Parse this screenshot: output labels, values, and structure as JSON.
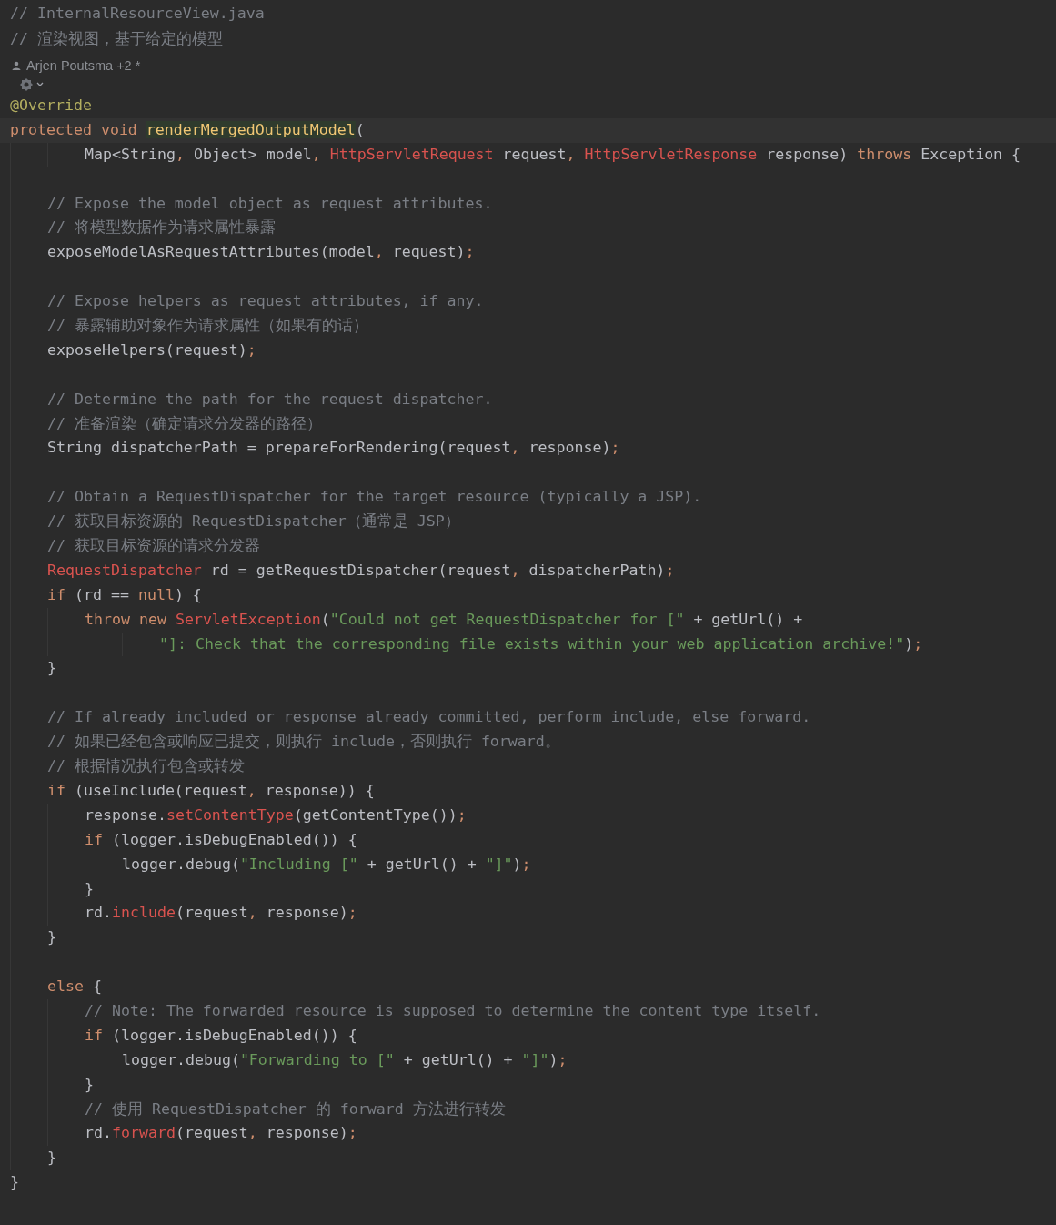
{
  "header_comments": [
    [
      {
        "kind": "comment",
        "text": "// InternalResourceView.java"
      }
    ],
    [
      {
        "kind": "comment",
        "text": "// 渲染视图，基于给定的模型"
      }
    ]
  ],
  "author_hint": {
    "text": "Arjen Poutsma +2 *"
  },
  "code": [
    {
      "kind": "line",
      "current": false,
      "tokens": [
        {
          "kind": "annotation",
          "text": "@Override"
        }
      ]
    },
    {
      "kind": "line",
      "current": true,
      "tokens": [
        {
          "kind": "keyword",
          "text": "protected void "
        },
        {
          "kind": "declaration",
          "text": "renderMergedOutputModel"
        },
        {
          "kind": "plain",
          "text": "("
        }
      ]
    },
    {
      "kind": "block",
      "children": [
        {
          "kind": "block",
          "children": [
            {
              "kind": "line",
              "current": false,
              "tokens": [
                {
                  "kind": "plain",
                  "text": "Map<String"
                },
                {
                  "kind": "punct",
                  "text": ","
                },
                {
                  "kind": "plain",
                  "text": " Object> model"
                },
                {
                  "kind": "punct",
                  "text": ", "
                },
                {
                  "kind": "type",
                  "text": "HttpServletRequest"
                },
                {
                  "kind": "plain",
                  "text": " request"
                },
                {
                  "kind": "punct",
                  "text": ", "
                },
                {
                  "kind": "type",
                  "text": "HttpServletResponse"
                },
                {
                  "kind": "plain",
                  "text": " response) "
                },
                {
                  "kind": "keyword",
                  "text": "throws"
                },
                {
                  "kind": "plain",
                  "text": " Exception {"
                }
              ]
            }
          ]
        },
        {
          "kind": "blank"
        },
        {
          "kind": "line",
          "current": false,
          "tokens": [
            {
              "kind": "comment",
              "text": "// Expose the model object as request attributes."
            }
          ]
        },
        {
          "kind": "line",
          "current": false,
          "tokens": [
            {
              "kind": "comment",
              "text": "// 将模型数据作为请求属性暴露"
            }
          ]
        },
        {
          "kind": "line",
          "current": false,
          "tokens": [
            {
              "kind": "plain",
              "text": "exposeModelAsRequestAttributes(model"
            },
            {
              "kind": "punct",
              "text": ","
            },
            {
              "kind": "plain",
              "text": " request)"
            },
            {
              "kind": "punct",
              "text": ";"
            }
          ]
        },
        {
          "kind": "blank"
        },
        {
          "kind": "line",
          "current": false,
          "tokens": [
            {
              "kind": "comment",
              "text": "// Expose helpers as request attributes, if any."
            }
          ]
        },
        {
          "kind": "line",
          "current": false,
          "tokens": [
            {
              "kind": "comment",
              "text": "// 暴露辅助对象作为请求属性（如果有的话）"
            }
          ]
        },
        {
          "kind": "line",
          "current": false,
          "tokens": [
            {
              "kind": "plain",
              "text": "exposeHelpers(request)"
            },
            {
              "kind": "punct",
              "text": ";"
            }
          ]
        },
        {
          "kind": "blank"
        },
        {
          "kind": "line",
          "current": false,
          "tokens": [
            {
              "kind": "comment",
              "text": "// Determine the path for the request dispatcher."
            }
          ]
        },
        {
          "kind": "line",
          "current": false,
          "tokens": [
            {
              "kind": "comment",
              "text": "// 准备渲染（确定请求分发器的路径）"
            }
          ]
        },
        {
          "kind": "line",
          "current": false,
          "tokens": [
            {
              "kind": "plain",
              "text": "String dispatcherPath = prepareForRendering(request"
            },
            {
              "kind": "punct",
              "text": ","
            },
            {
              "kind": "plain",
              "text": " response)"
            },
            {
              "kind": "punct",
              "text": ";"
            }
          ]
        },
        {
          "kind": "blank"
        },
        {
          "kind": "line",
          "current": false,
          "tokens": [
            {
              "kind": "comment",
              "text": "// Obtain a RequestDispatcher for the target resource (typically a JSP)."
            }
          ]
        },
        {
          "kind": "line",
          "current": false,
          "tokens": [
            {
              "kind": "comment",
              "text": "// 获取目标资源的 RequestDispatcher（通常是 JSP）"
            }
          ]
        },
        {
          "kind": "line",
          "current": false,
          "tokens": [
            {
              "kind": "comment",
              "text": "// 获取目标资源的请求分发器"
            }
          ]
        },
        {
          "kind": "line",
          "current": false,
          "tokens": [
            {
              "kind": "type",
              "text": "RequestDispatcher"
            },
            {
              "kind": "plain",
              "text": " rd = getRequestDispatcher(request"
            },
            {
              "kind": "punct",
              "text": ","
            },
            {
              "kind": "plain",
              "text": " dispatcherPath)"
            },
            {
              "kind": "punct",
              "text": ";"
            }
          ]
        },
        {
          "kind": "line",
          "current": false,
          "tokens": [
            {
              "kind": "keyword",
              "text": "if"
            },
            {
              "kind": "plain",
              "text": " (rd == "
            },
            {
              "kind": "keyword",
              "text": "null"
            },
            {
              "kind": "plain",
              "text": ") {"
            }
          ]
        },
        {
          "kind": "block",
          "children": [
            {
              "kind": "line",
              "current": false,
              "tokens": [
                {
                  "kind": "keyword",
                  "text": "throw new "
                },
                {
                  "kind": "type",
                  "text": "ServletException"
                },
                {
                  "kind": "plain",
                  "text": "("
                },
                {
                  "kind": "string",
                  "text": "\"Could not get RequestDispatcher for [\""
                },
                {
                  "kind": "plain",
                  "text": " + getUrl() +"
                }
              ]
            },
            {
              "kind": "block",
              "children": [
                {
                  "kind": "block",
                  "children": [
                    {
                      "kind": "line",
                      "current": false,
                      "tokens": [
                        {
                          "kind": "string",
                          "text": "\"]: Check that the corresponding file exists within your web application archive!\""
                        },
                        {
                          "kind": "plain",
                          "text": ")"
                        },
                        {
                          "kind": "punct",
                          "text": ";"
                        }
                      ]
                    }
                  ]
                }
              ]
            }
          ]
        },
        {
          "kind": "line",
          "current": false,
          "tokens": [
            {
              "kind": "plain",
              "text": "}"
            }
          ]
        },
        {
          "kind": "blank"
        },
        {
          "kind": "line",
          "current": false,
          "tokens": [
            {
              "kind": "comment",
              "text": "// If already included or response already committed, perform include, else forward."
            }
          ]
        },
        {
          "kind": "line",
          "current": false,
          "tokens": [
            {
              "kind": "comment",
              "text": "// 如果已经包含或响应已提交，则执行 include，否则执行 forward。"
            }
          ]
        },
        {
          "kind": "line",
          "current": false,
          "tokens": [
            {
              "kind": "comment",
              "text": "// 根据情况执行包含或转发"
            }
          ]
        },
        {
          "kind": "line",
          "current": false,
          "tokens": [
            {
              "kind": "keyword",
              "text": "if"
            },
            {
              "kind": "plain",
              "text": " (useInclude(request"
            },
            {
              "kind": "punct",
              "text": ","
            },
            {
              "kind": "plain",
              "text": " response)) {"
            }
          ]
        },
        {
          "kind": "block",
          "children": [
            {
              "kind": "line",
              "current": false,
              "tokens": [
                {
                  "kind": "plain",
                  "text": "response."
                },
                {
                  "kind": "call",
                  "text": "setContentType"
                },
                {
                  "kind": "plain",
                  "text": "(getContentType())"
                },
                {
                  "kind": "punct",
                  "text": ";"
                }
              ]
            },
            {
              "kind": "line",
              "current": false,
              "tokens": [
                {
                  "kind": "keyword",
                  "text": "if"
                },
                {
                  "kind": "plain",
                  "text": " (logger.isDebugEnabled()) {"
                }
              ]
            },
            {
              "kind": "block",
              "children": [
                {
                  "kind": "line",
                  "current": false,
                  "tokens": [
                    {
                      "kind": "plain",
                      "text": "logger.debug("
                    },
                    {
                      "kind": "string",
                      "text": "\"Including [\""
                    },
                    {
                      "kind": "plain",
                      "text": " + getUrl() + "
                    },
                    {
                      "kind": "string",
                      "text": "\"]\""
                    },
                    {
                      "kind": "plain",
                      "text": ")"
                    },
                    {
                      "kind": "punct",
                      "text": ";"
                    }
                  ]
                }
              ]
            },
            {
              "kind": "line",
              "current": false,
              "tokens": [
                {
                  "kind": "plain",
                  "text": "}"
                }
              ]
            },
            {
              "kind": "line",
              "current": false,
              "tokens": [
                {
                  "kind": "plain",
                  "text": "rd."
                },
                {
                  "kind": "call",
                  "text": "include"
                },
                {
                  "kind": "plain",
                  "text": "(request"
                },
                {
                  "kind": "punct",
                  "text": ","
                },
                {
                  "kind": "plain",
                  "text": " response)"
                },
                {
                  "kind": "punct",
                  "text": ";"
                }
              ]
            }
          ]
        },
        {
          "kind": "line",
          "current": false,
          "tokens": [
            {
              "kind": "plain",
              "text": "}"
            }
          ]
        },
        {
          "kind": "blank"
        },
        {
          "kind": "line",
          "current": false,
          "tokens": [
            {
              "kind": "keyword",
              "text": "else"
            },
            {
              "kind": "plain",
              "text": " {"
            }
          ]
        },
        {
          "kind": "block",
          "children": [
            {
              "kind": "line",
              "current": false,
              "tokens": [
                {
                  "kind": "comment",
                  "text": "// Note: The forwarded resource is supposed to determine the content type itself."
                }
              ]
            },
            {
              "kind": "line",
              "current": false,
              "tokens": [
                {
                  "kind": "keyword",
                  "text": "if"
                },
                {
                  "kind": "plain",
                  "text": " (logger.isDebugEnabled()) {"
                }
              ]
            },
            {
              "kind": "block",
              "children": [
                {
                  "kind": "line",
                  "current": false,
                  "tokens": [
                    {
                      "kind": "plain",
                      "text": "logger.debug("
                    },
                    {
                      "kind": "string",
                      "text": "\"Forwarding to [\""
                    },
                    {
                      "kind": "plain",
                      "text": " + getUrl() + "
                    },
                    {
                      "kind": "string",
                      "text": "\"]\""
                    },
                    {
                      "kind": "plain",
                      "text": ")"
                    },
                    {
                      "kind": "punct",
                      "text": ";"
                    }
                  ]
                }
              ]
            },
            {
              "kind": "line",
              "current": false,
              "tokens": [
                {
                  "kind": "plain",
                  "text": "}"
                }
              ]
            },
            {
              "kind": "line",
              "current": false,
              "tokens": [
                {
                  "kind": "comment",
                  "text": "// 使用 RequestDispatcher 的 forward 方法进行转发"
                }
              ]
            },
            {
              "kind": "line",
              "current": false,
              "tokens": [
                {
                  "kind": "plain",
                  "text": "rd."
                },
                {
                  "kind": "call",
                  "text": "forward"
                },
                {
                  "kind": "plain",
                  "text": "(request"
                },
                {
                  "kind": "punct",
                  "text": ","
                },
                {
                  "kind": "plain",
                  "text": " response)"
                },
                {
                  "kind": "punct",
                  "text": ";"
                }
              ]
            }
          ]
        },
        {
          "kind": "line",
          "current": false,
          "tokens": [
            {
              "kind": "plain",
              "text": "}"
            }
          ]
        }
      ]
    },
    {
      "kind": "line",
      "current": false,
      "tokens": [
        {
          "kind": "plain",
          "text": "}"
        }
      ]
    }
  ]
}
